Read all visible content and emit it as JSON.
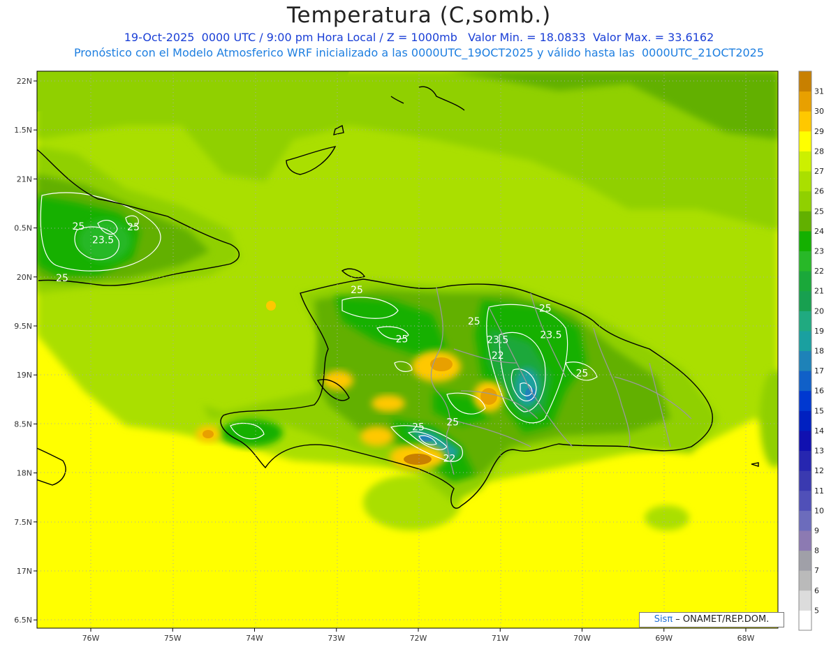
{
  "title": "Temperatura (C,somb.)",
  "subtitle_line1": "19-Oct-2025  0000 UTC / 9:00 pm Hora Local / Z = 1000mb   Valor Min. = 18.0833  Valor Max. = 33.6162",
  "subtitle_line2": "Pronóstico con el Modelo Atmosferico WRF inicializado a las 0000UTC_19OCT2025 y válido hasta las  0000UTC_21OCT2025",
  "credit": {
    "brand": "Sisπ",
    "text": " – ONAMET/REP.DOM."
  },
  "chart_data": {
    "type": "heatmap",
    "x_axis": {
      "ticks": [
        -76,
        -75,
        -74,
        -73,
        -72,
        -71,
        -70,
        -69,
        -68
      ],
      "labels": [
        "76W",
        "75W",
        "74W",
        "73W",
        "72W",
        "71W",
        "70W",
        "69W",
        "68W"
      ]
    },
    "y_axis": {
      "ticks": [
        22,
        21.5,
        21,
        20.5,
        20,
        19.5,
        19,
        18.5,
        18,
        17.5,
        17,
        16.5
      ],
      "labels": [
        "22N",
        "1.5N",
        "21N",
        "0.5N",
        "20N",
        "9.5N",
        "19N",
        "8.5N",
        "18N",
        "7.5N",
        "17N",
        "6.5N"
      ]
    },
    "grid": true,
    "colorbar": {
      "labels": [
        5,
        6,
        7,
        8,
        9,
        10,
        11,
        12,
        13,
        14,
        15,
        16,
        17,
        18,
        19,
        20,
        21,
        22,
        23,
        24,
        25,
        26,
        27,
        28,
        29,
        30,
        31
      ],
      "colors": [
        "#ffffff",
        "#dcdcdc",
        "#bababa",
        "#a0a0a8",
        "#8c7ab2",
        "#6c6cbc",
        "#5050b8",
        "#3a3ab0",
        "#2626b0",
        "#1010b0",
        "#0020c0",
        "#0038d0",
        "#1060c8",
        "#1e82b8",
        "#1aa0a0",
        "#20aa80",
        "#18a050",
        "#1aa83a",
        "#28b828",
        "#14b000",
        "#62b000",
        "#90d000",
        "#aadf00",
        "#ccf000",
        "#ffff00",
        "#ffc800",
        "#e8a000",
        "#c88000"
      ]
    },
    "contour_labels": [
      {
        "text": "25",
        "lon": -76.15,
        "lat": 20.52
      },
      {
        "text": "25",
        "lon": -75.48,
        "lat": 20.51
      },
      {
        "text": "23.5",
        "lon": -75.85,
        "lat": 20.38
      },
      {
        "text": "25",
        "lon": -76.35,
        "lat": 19.99
      },
      {
        "text": "25",
        "lon": -72.75,
        "lat": 19.87
      },
      {
        "text": "25",
        "lon": -70.45,
        "lat": 19.68
      },
      {
        "text": "25",
        "lon": -71.32,
        "lat": 19.55
      },
      {
        "text": "25",
        "lon": -72.2,
        "lat": 19.37
      },
      {
        "text": "23.5",
        "lon": -71.03,
        "lat": 19.36
      },
      {
        "text": "23.5",
        "lon": -70.38,
        "lat": 19.41
      },
      {
        "text": "22",
        "lon": -71.03,
        "lat": 19.2
      },
      {
        "text": "25",
        "lon": -70.0,
        "lat": 19.02
      },
      {
        "text": "25",
        "lon": -72.0,
        "lat": 18.47
      },
      {
        "text": "25",
        "lon": -71.58,
        "lat": 18.52
      },
      {
        "text": "22",
        "lon": -71.62,
        "lat": 18.15
      }
    ]
  }
}
